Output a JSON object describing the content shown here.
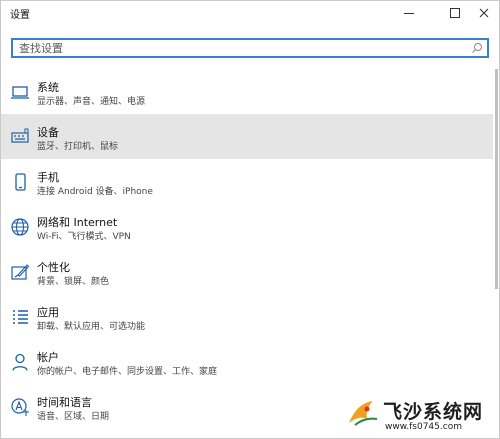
{
  "window": {
    "title": "设置",
    "minimize": "—",
    "maximize": "☐",
    "close": "✕"
  },
  "search": {
    "placeholder": "查找设置",
    "value": ""
  },
  "items": [
    {
      "label": "系统",
      "desc": "显示器、声音、通知、电源",
      "icon": "laptop-icon",
      "selected": false
    },
    {
      "label": "设备",
      "desc": "蓝牙、打印机、鼠标",
      "icon": "keyboard-icon",
      "selected": true
    },
    {
      "label": "手机",
      "desc": "连接 Android 设备、iPhone",
      "icon": "phone-icon",
      "selected": false
    },
    {
      "label": "网络和 Internet",
      "desc": "Wi-Fi、飞行模式、VPN",
      "icon": "globe-icon",
      "selected": false
    },
    {
      "label": "个性化",
      "desc": "背景、锁屏、颜色",
      "icon": "paint-icon",
      "selected": false
    },
    {
      "label": "应用",
      "desc": "卸载、默认应用、可选功能",
      "icon": "apps-list-icon",
      "selected": false
    },
    {
      "label": "帐户",
      "desc": "你的帐户、电子邮件、同步设置、工作、家庭",
      "icon": "person-icon",
      "selected": false
    },
    {
      "label": "时间和语言",
      "desc": "语音、区域、日期",
      "icon": "time-language-icon",
      "selected": false
    }
  ],
  "watermark": {
    "title": "飞沙系统网",
    "url": "www.fs0745.com"
  }
}
